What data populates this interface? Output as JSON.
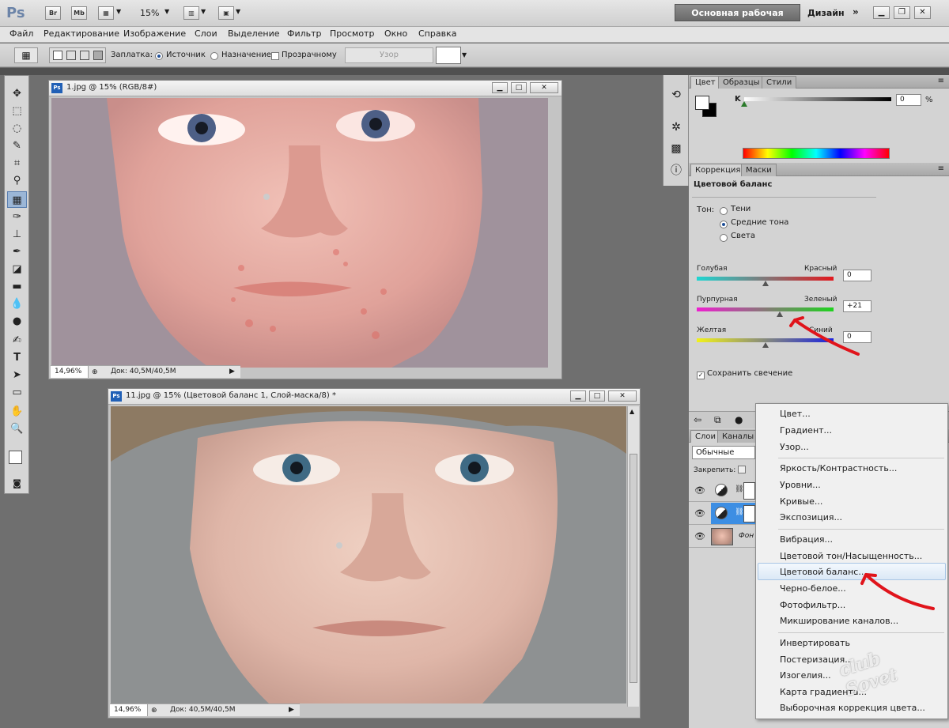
{
  "app": {
    "logo": "Ps",
    "launch_buttons": [
      "Br",
      "Mb"
    ],
    "zoom": "15%",
    "workspace": "Основная рабочая среда",
    "design": "Дизайн",
    "chevron": "»"
  },
  "menu": [
    "Файл",
    "Редактирование",
    "Изображение",
    "Слои",
    "Выделение",
    "Фильтр",
    "Просмотр",
    "Окно",
    "Справка"
  ],
  "options": {
    "patch_label": "Заплатка:",
    "source": "Источник",
    "destination": "Назначение",
    "transparent": "Прозрачному",
    "pattern_button": "Узор"
  },
  "doc1": {
    "title": "1.jpg @ 15% (RGB/8#)",
    "zoom": "14,96%",
    "doc_size": "Док: 40,5M/40,5M"
  },
  "doc2": {
    "title": "11.jpg @ 15% (Цветовой баланс 1, Слой-маска/8) *",
    "zoom": "14,96%",
    "doc_size": "Док: 40,5M/40,5M"
  },
  "color_panel": {
    "tabs": [
      "Цвет",
      "Образцы",
      "Стили"
    ],
    "channel": "K",
    "value": "0",
    "unit": "%"
  },
  "adjust_panel": {
    "tabs": [
      "Коррекция",
      "Маски"
    ],
    "title": "Цветовой баланс",
    "tone_label": "Тон:",
    "tones": [
      "Тени",
      "Средние тона",
      "Света"
    ],
    "selected_tone": "Средние тона",
    "sliders": [
      {
        "left": "Голубая",
        "right": "Красный",
        "value": "0",
        "level": 0
      },
      {
        "left": "Пурпурная",
        "right": "Зеленый",
        "value": "+21",
        "level": 21
      },
      {
        "left": "Желтая",
        "right": "Синий",
        "value": "0",
        "level": 0
      }
    ],
    "preserve": "Сохранить свечение"
  },
  "layers_panel": {
    "tabs": [
      "Слои",
      "Каналы"
    ],
    "blend_mode": "Обычные",
    "lock_label": "Закрепить:",
    "background_layer": "Фон"
  },
  "context_menu": {
    "groups": [
      [
        "Цвет...",
        "Градиент...",
        "Узор..."
      ],
      [
        "Яркость/Контрастность...",
        "Уровни...",
        "Кривые...",
        "Экспозиция..."
      ],
      [
        "Вибрация...",
        "Цветовой тон/Насыщенность...",
        "Цветовой баланс...",
        "Черно-белое...",
        "Фотофильтр...",
        "Микширование каналов..."
      ],
      [
        "Инвертировать",
        "Постеризация...",
        "Изогелия...",
        "Карта градиента...",
        "Выборочная коррекция цвета..."
      ]
    ],
    "highlighted": "Цветовой баланс..."
  },
  "watermark": "club Sovet",
  "colors": {
    "accent": "#1e4e96",
    "annotation": "#e0141b",
    "highlight": "#dbe8f6"
  }
}
